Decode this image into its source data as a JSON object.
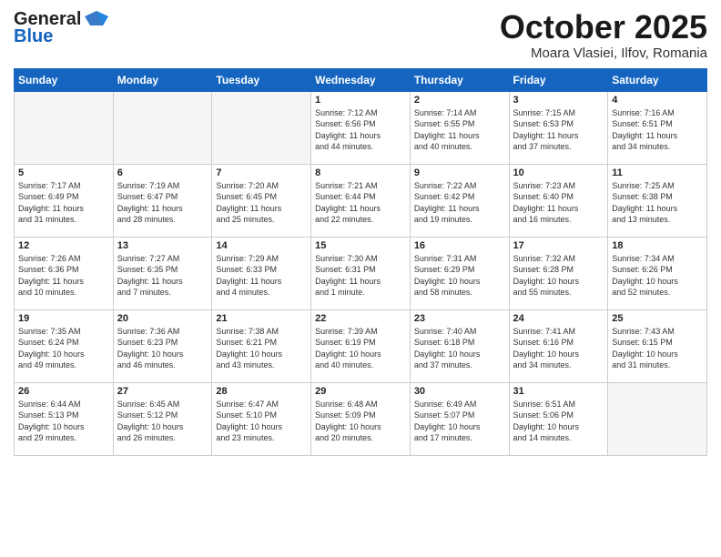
{
  "header": {
    "logo_line1": "General",
    "logo_line2": "Blue",
    "month": "October 2025",
    "location": "Moara Vlasiei, Ilfov, Romania"
  },
  "weekdays": [
    "Sunday",
    "Monday",
    "Tuesday",
    "Wednesday",
    "Thursday",
    "Friday",
    "Saturday"
  ],
  "weeks": [
    [
      {
        "day": "",
        "info": "",
        "empty": true
      },
      {
        "day": "",
        "info": "",
        "empty": true
      },
      {
        "day": "",
        "info": "",
        "empty": true
      },
      {
        "day": "1",
        "info": "Sunrise: 7:12 AM\nSunset: 6:56 PM\nDaylight: 11 hours\nand 44 minutes.",
        "empty": false
      },
      {
        "day": "2",
        "info": "Sunrise: 7:14 AM\nSunset: 6:55 PM\nDaylight: 11 hours\nand 40 minutes.",
        "empty": false
      },
      {
        "day": "3",
        "info": "Sunrise: 7:15 AM\nSunset: 6:53 PM\nDaylight: 11 hours\nand 37 minutes.",
        "empty": false
      },
      {
        "day": "4",
        "info": "Sunrise: 7:16 AM\nSunset: 6:51 PM\nDaylight: 11 hours\nand 34 minutes.",
        "empty": false
      }
    ],
    [
      {
        "day": "5",
        "info": "Sunrise: 7:17 AM\nSunset: 6:49 PM\nDaylight: 11 hours\nand 31 minutes.",
        "empty": false
      },
      {
        "day": "6",
        "info": "Sunrise: 7:19 AM\nSunset: 6:47 PM\nDaylight: 11 hours\nand 28 minutes.",
        "empty": false
      },
      {
        "day": "7",
        "info": "Sunrise: 7:20 AM\nSunset: 6:45 PM\nDaylight: 11 hours\nand 25 minutes.",
        "empty": false
      },
      {
        "day": "8",
        "info": "Sunrise: 7:21 AM\nSunset: 6:44 PM\nDaylight: 11 hours\nand 22 minutes.",
        "empty": false
      },
      {
        "day": "9",
        "info": "Sunrise: 7:22 AM\nSunset: 6:42 PM\nDaylight: 11 hours\nand 19 minutes.",
        "empty": false
      },
      {
        "day": "10",
        "info": "Sunrise: 7:23 AM\nSunset: 6:40 PM\nDaylight: 11 hours\nand 16 minutes.",
        "empty": false
      },
      {
        "day": "11",
        "info": "Sunrise: 7:25 AM\nSunset: 6:38 PM\nDaylight: 11 hours\nand 13 minutes.",
        "empty": false
      }
    ],
    [
      {
        "day": "12",
        "info": "Sunrise: 7:26 AM\nSunset: 6:36 PM\nDaylight: 11 hours\nand 10 minutes.",
        "empty": false
      },
      {
        "day": "13",
        "info": "Sunrise: 7:27 AM\nSunset: 6:35 PM\nDaylight: 11 hours\nand 7 minutes.",
        "empty": false
      },
      {
        "day": "14",
        "info": "Sunrise: 7:29 AM\nSunset: 6:33 PM\nDaylight: 11 hours\nand 4 minutes.",
        "empty": false
      },
      {
        "day": "15",
        "info": "Sunrise: 7:30 AM\nSunset: 6:31 PM\nDaylight: 11 hours\nand 1 minute.",
        "empty": false
      },
      {
        "day": "16",
        "info": "Sunrise: 7:31 AM\nSunset: 6:29 PM\nDaylight: 10 hours\nand 58 minutes.",
        "empty": false
      },
      {
        "day": "17",
        "info": "Sunrise: 7:32 AM\nSunset: 6:28 PM\nDaylight: 10 hours\nand 55 minutes.",
        "empty": false
      },
      {
        "day": "18",
        "info": "Sunrise: 7:34 AM\nSunset: 6:26 PM\nDaylight: 10 hours\nand 52 minutes.",
        "empty": false
      }
    ],
    [
      {
        "day": "19",
        "info": "Sunrise: 7:35 AM\nSunset: 6:24 PM\nDaylight: 10 hours\nand 49 minutes.",
        "empty": false
      },
      {
        "day": "20",
        "info": "Sunrise: 7:36 AM\nSunset: 6:23 PM\nDaylight: 10 hours\nand 46 minutes.",
        "empty": false
      },
      {
        "day": "21",
        "info": "Sunrise: 7:38 AM\nSunset: 6:21 PM\nDaylight: 10 hours\nand 43 minutes.",
        "empty": false
      },
      {
        "day": "22",
        "info": "Sunrise: 7:39 AM\nSunset: 6:19 PM\nDaylight: 10 hours\nand 40 minutes.",
        "empty": false
      },
      {
        "day": "23",
        "info": "Sunrise: 7:40 AM\nSunset: 6:18 PM\nDaylight: 10 hours\nand 37 minutes.",
        "empty": false
      },
      {
        "day": "24",
        "info": "Sunrise: 7:41 AM\nSunset: 6:16 PM\nDaylight: 10 hours\nand 34 minutes.",
        "empty": false
      },
      {
        "day": "25",
        "info": "Sunrise: 7:43 AM\nSunset: 6:15 PM\nDaylight: 10 hours\nand 31 minutes.",
        "empty": false
      }
    ],
    [
      {
        "day": "26",
        "info": "Sunrise: 6:44 AM\nSunset: 5:13 PM\nDaylight: 10 hours\nand 29 minutes.",
        "empty": false
      },
      {
        "day": "27",
        "info": "Sunrise: 6:45 AM\nSunset: 5:12 PM\nDaylight: 10 hours\nand 26 minutes.",
        "empty": false
      },
      {
        "day": "28",
        "info": "Sunrise: 6:47 AM\nSunset: 5:10 PM\nDaylight: 10 hours\nand 23 minutes.",
        "empty": false
      },
      {
        "day": "29",
        "info": "Sunrise: 6:48 AM\nSunset: 5:09 PM\nDaylight: 10 hours\nand 20 minutes.",
        "empty": false
      },
      {
        "day": "30",
        "info": "Sunrise: 6:49 AM\nSunset: 5:07 PM\nDaylight: 10 hours\nand 17 minutes.",
        "empty": false
      },
      {
        "day": "31",
        "info": "Sunrise: 6:51 AM\nSunset: 5:06 PM\nDaylight: 10 hours\nand 14 minutes.",
        "empty": false
      },
      {
        "day": "",
        "info": "",
        "empty": true
      }
    ]
  ]
}
